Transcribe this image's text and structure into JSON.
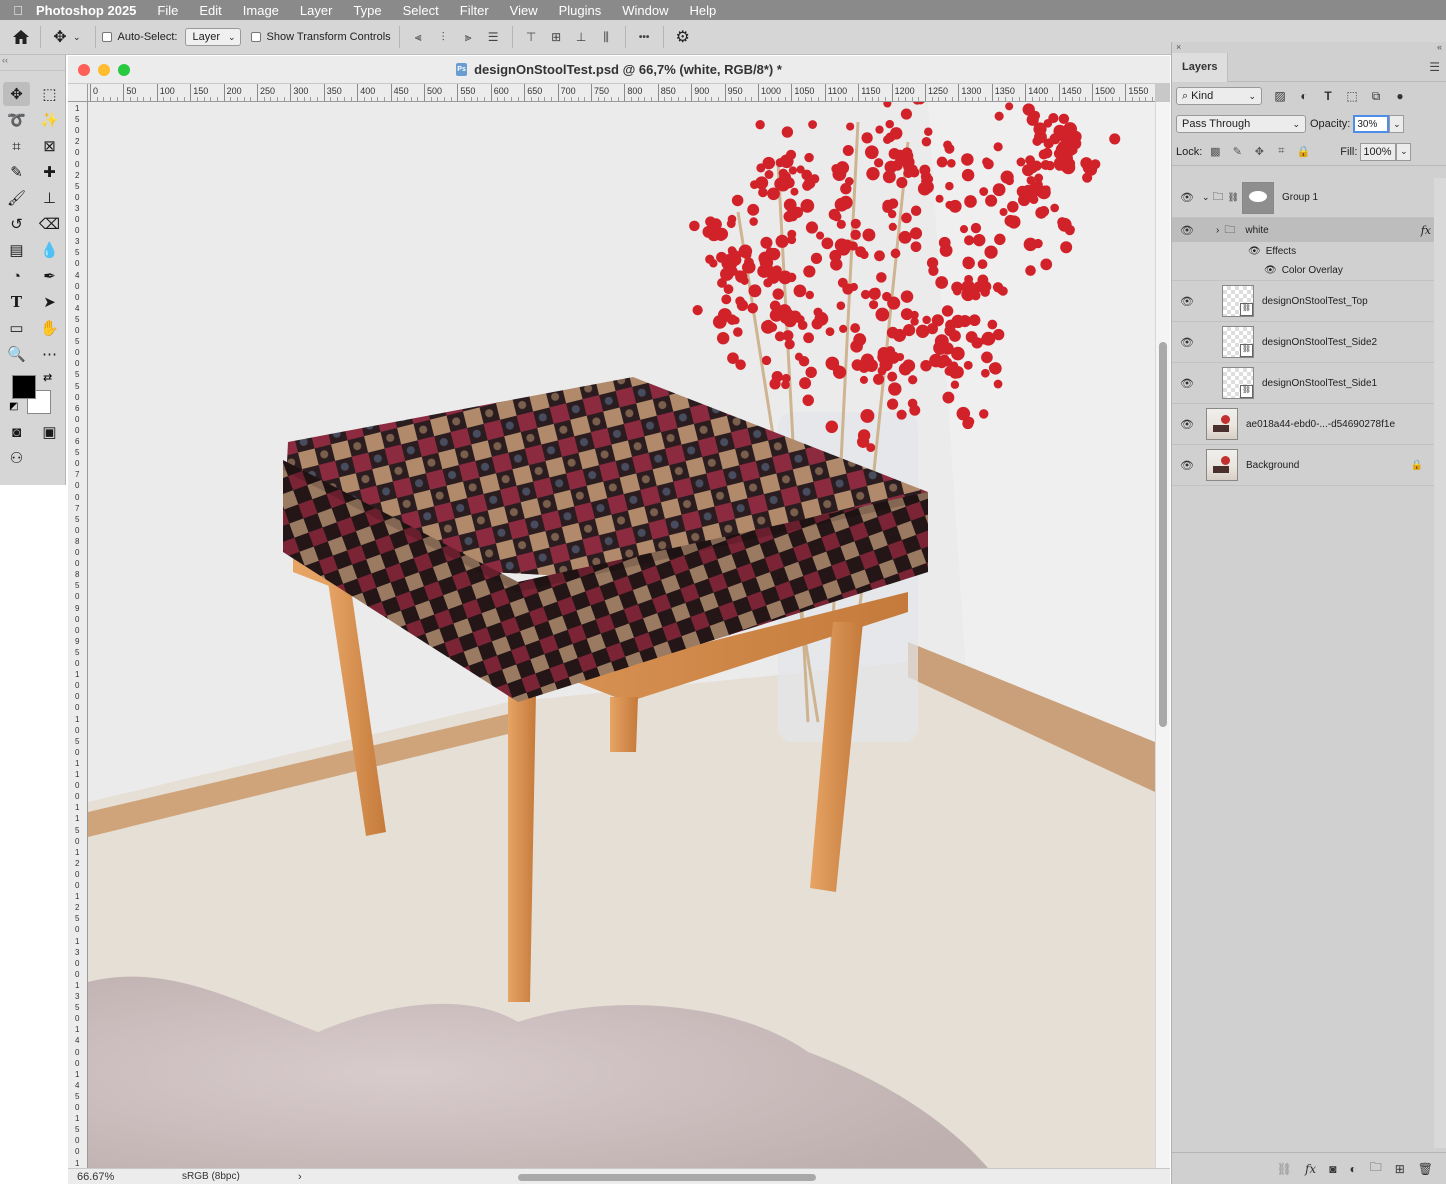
{
  "menubar": {
    "apple_icon": "apple-icon",
    "app_name": "Photoshop 2025",
    "items": [
      "File",
      "Edit",
      "Image",
      "Layer",
      "Type",
      "Select",
      "Filter",
      "View",
      "Plugins",
      "Window",
      "Help"
    ]
  },
  "options": {
    "auto_select_label": "Auto-Select:",
    "auto_select_value": "Layer",
    "show_transform_label": "Show Transform Controls",
    "more_glyph": "•••"
  },
  "document": {
    "title": "designOnStoolTest.psd @ 66,7% (white, RGB/8*) *",
    "ps_badge": "Ps",
    "zoom": "66.67%",
    "profile": "sRGB (8bpc)",
    "status_arrow": "›",
    "ruler_top": [
      "0",
      "50",
      "100",
      "150",
      "200",
      "250",
      "300",
      "350",
      "400",
      "450",
      "500",
      "550",
      "600",
      "650",
      "700",
      "750",
      "800",
      "850",
      "900",
      "950",
      "1000",
      "1050",
      "1100",
      "1150",
      "1200",
      "1250",
      "1300",
      "1350",
      "1400",
      "1450",
      "1500",
      "1550"
    ],
    "ruler_left": [
      "1",
      "5",
      "0",
      "2",
      "0",
      "0",
      "2",
      "5",
      "0",
      "3",
      "0",
      "0",
      "3",
      "5",
      "0",
      "4",
      "0",
      "0",
      "4",
      "5",
      "0",
      "5",
      "0",
      "0",
      "5",
      "5",
      "0",
      "6",
      "0",
      "0",
      "6",
      "5",
      "0",
      "7",
      "0",
      "0",
      "7",
      "5",
      "0",
      "8",
      "0",
      "0",
      "8",
      "5",
      "0",
      "9",
      "0",
      "0",
      "9",
      "5",
      "0",
      "1",
      "0",
      "0",
      "0",
      "1",
      "0",
      "5",
      "0",
      "1",
      "1",
      "0",
      "0",
      "1",
      "1",
      "5",
      "0",
      "1",
      "2",
      "0",
      "0",
      "1",
      "2",
      "5",
      "0",
      "1",
      "3",
      "0",
      "0",
      "1",
      "3",
      "5",
      "0",
      "1",
      "4",
      "0",
      "0",
      "1",
      "4",
      "5",
      "0",
      "1",
      "5",
      "0",
      "0",
      "1",
      "5",
      "5",
      "0"
    ]
  },
  "layers_panel": {
    "tab_title": "Layers",
    "close_glyph": "×",
    "collapse_glyph": "«",
    "filter_kind": "Kind",
    "blend_mode": "Pass Through",
    "opacity_label": "Opacity:",
    "opacity_value": "30%",
    "lock_label": "Lock:",
    "fill_label": "Fill:",
    "fill_value": "100%",
    "fx_glyph": "fx",
    "layers": [
      {
        "name": "Group 1"
      },
      {
        "name": "white"
      },
      {
        "name": "designOnStoolTest_Top"
      },
      {
        "name": "designOnStoolTest_Side2"
      },
      {
        "name": "designOnStoolTest_Side1"
      },
      {
        "name": "ae018a44-ebd0-...-d54690278f1e"
      },
      {
        "name": "Background"
      }
    ],
    "effects_label": "Effects",
    "color_overlay_label": "Color Overlay"
  },
  "colors": {
    "menubar_bg": "#8a8a8a",
    "panel_bg": "#d6d6d6",
    "selected_layer_bg": "#bdbdbd",
    "opacity_focus": "#4c8ee8",
    "seat_red": "#8a2b3e",
    "seat_dark": "#2a1c1e",
    "wood": "#d99355",
    "berry_red": "#d1222a"
  }
}
